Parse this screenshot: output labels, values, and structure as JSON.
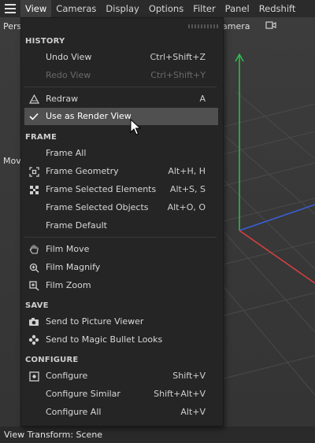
{
  "menubar": {
    "items": [
      "View",
      "Cameras",
      "Display",
      "Options",
      "Filter",
      "Panel",
      "Redshift"
    ]
  },
  "viewport": {
    "top_label": "Pers",
    "camera_label": "amera",
    "side_label": "Mov"
  },
  "status": "View Transform: Scene",
  "menu": {
    "sections": {
      "history": "HISTORY",
      "frame": "FRAME",
      "save": "SAVE",
      "configure": "CONFIGURE"
    },
    "items": [
      {
        "label": "Undo View",
        "shortcut": "Ctrl+Shift+Z",
        "icon": "",
        "disabled": false
      },
      {
        "label": "Redo View",
        "shortcut": "Ctrl+Shift+Y",
        "icon": "",
        "disabled": true
      },
      {
        "label": "Redraw",
        "shortcut": "A",
        "icon": "redraw-icon",
        "disabled": false
      },
      {
        "label": "Use as Render View",
        "shortcut": "",
        "icon": "checkmark-icon",
        "disabled": false,
        "highlighted": true,
        "checked": true
      },
      {
        "label": "Frame All",
        "shortcut": "",
        "icon": "",
        "disabled": false
      },
      {
        "label": "Frame Geometry",
        "shortcut": "Alt+H, H",
        "icon": "frame-geometry-icon",
        "disabled": false
      },
      {
        "label": "Frame Selected Elements",
        "shortcut": "Alt+S, S",
        "icon": "frame-selected-elements-icon",
        "disabled": false
      },
      {
        "label": "Frame Selected Objects",
        "shortcut": "Alt+O, O",
        "icon": "",
        "disabled": false
      },
      {
        "label": "Frame Default",
        "shortcut": "",
        "icon": "",
        "disabled": false
      },
      {
        "label": "Film Move",
        "shortcut": "",
        "icon": "hand-icon",
        "disabled": false
      },
      {
        "label": "Film Magnify",
        "shortcut": "",
        "icon": "magnify-icon",
        "disabled": false
      },
      {
        "label": "Film Zoom",
        "shortcut": "",
        "icon": "zoom-icon",
        "disabled": false
      },
      {
        "label": "Send to Picture Viewer",
        "shortcut": "",
        "icon": "camera-icon",
        "disabled": false
      },
      {
        "label": "Send to Magic Bullet Looks",
        "shortcut": "",
        "icon": "magic-bullet-icon",
        "disabled": false
      },
      {
        "label": "Configure",
        "shortcut": "Shift+V",
        "icon": "configure-icon",
        "disabled": false
      },
      {
        "label": "Configure Similar",
        "shortcut": "Shift+Alt+V",
        "icon": "",
        "disabled": false
      },
      {
        "label": "Configure All",
        "shortcut": "Alt+V",
        "icon": "",
        "disabled": false
      }
    ]
  },
  "colors": {
    "axis_y": "#2fbf4f",
    "axis_x": "#d94040",
    "axis_z": "#3a5fd8",
    "highlight": "#505050"
  }
}
